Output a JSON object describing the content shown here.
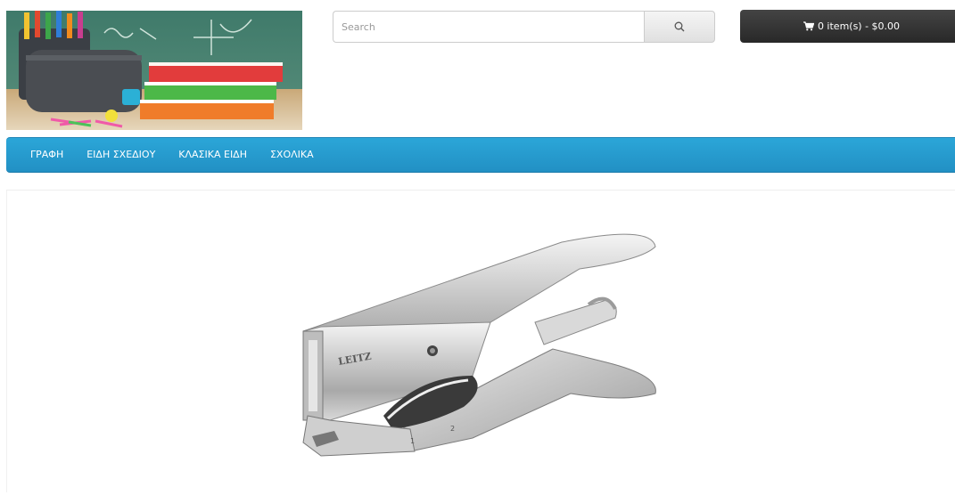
{
  "search": {
    "placeholder": "Search"
  },
  "cart": {
    "label": "0 item(s) - $0.00"
  },
  "menu": {
    "items": [
      {
        "label": "ΓΡΑΦΗ"
      },
      {
        "label": "ΕΙΔΗ ΣΧΕΔΙΟΥ"
      },
      {
        "label": "ΚΛΑΣΙΚΑ ΕΙΔΗ"
      },
      {
        "label": "ΣΧΟΛΙΚΑ"
      }
    ]
  },
  "product": {
    "brand": "LEITZ"
  },
  "icons": {
    "search": "search-icon",
    "cart": "shopping-cart-icon"
  },
  "colors": {
    "menu": "#2ba6d8",
    "cart_button": "#333333"
  }
}
